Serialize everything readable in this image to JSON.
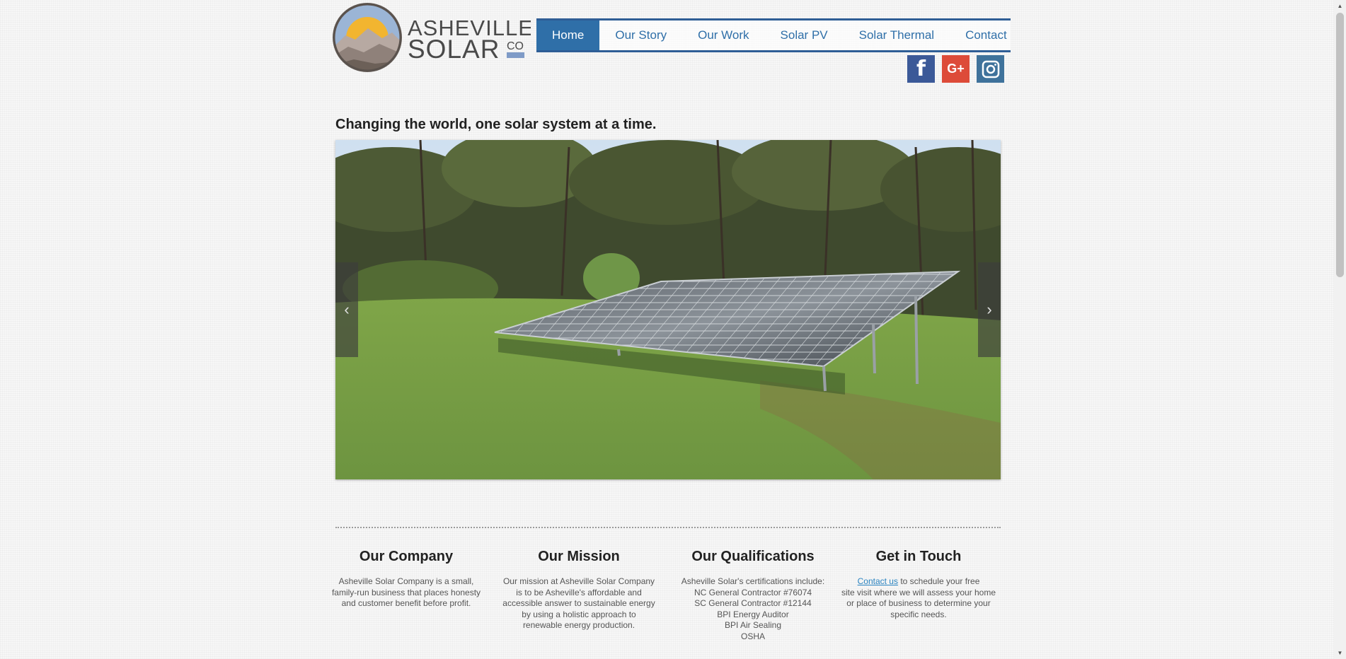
{
  "brand": {
    "logo_line1": "ASHEVILLE",
    "logo_line2": "SOLAR",
    "logo_suffix": "CO"
  },
  "nav": {
    "items": [
      {
        "label": "Home",
        "active": true
      },
      {
        "label": "Our Story",
        "active": false
      },
      {
        "label": "Our Work",
        "active": false
      },
      {
        "label": "Solar PV",
        "active": false
      },
      {
        "label": "Solar Thermal",
        "active": false
      },
      {
        "label": "Contact",
        "active": false
      }
    ]
  },
  "social": {
    "facebook_icon": "facebook-icon",
    "googleplus_icon": "google-plus-icon",
    "instagram_icon": "instagram-icon",
    "googleplus_text": "G+",
    "facebook_text": "f"
  },
  "hero": {
    "tagline": "Changing the world, one solar system at a time.",
    "prev_arrow": "‹",
    "next_arrow": "›"
  },
  "sections": {
    "company": {
      "title": "Our Company",
      "lines": [
        "Asheville Solar Company is a small,",
        "family-run business that places honesty",
        "and customer benefit before profit."
      ]
    },
    "mission": {
      "title": "Our Mission",
      "lines": [
        "Our mission at Asheville Solar Company",
        "is to be Asheville's affordable and",
        "accessible answer to sustainable energy",
        "by using a holistic approach to",
        "renewable energy production."
      ]
    },
    "qualifications": {
      "title": "Our Qualifications",
      "lines": [
        "Asheville Solar's certifications include:",
        "NC General Contractor #76074",
        "SC General Contractor #12144",
        "BPI Energy Auditor",
        "BPI Air Sealing",
        "OSHA"
      ]
    },
    "contact": {
      "title": "Get in Touch",
      "link_text": "Contact us",
      "line1_rest": " to schedule your free",
      "lines": [
        "site visit where we will assess your home",
        "or place of business to determine your",
        "specific needs."
      ]
    }
  },
  "colors": {
    "nav_accent": "#2f6fa8",
    "nav_border": "#2f5e96",
    "facebook": "#3b5998",
    "googleplus": "#dd4b39",
    "instagram": "#3f729b",
    "link": "#2b84c1"
  }
}
